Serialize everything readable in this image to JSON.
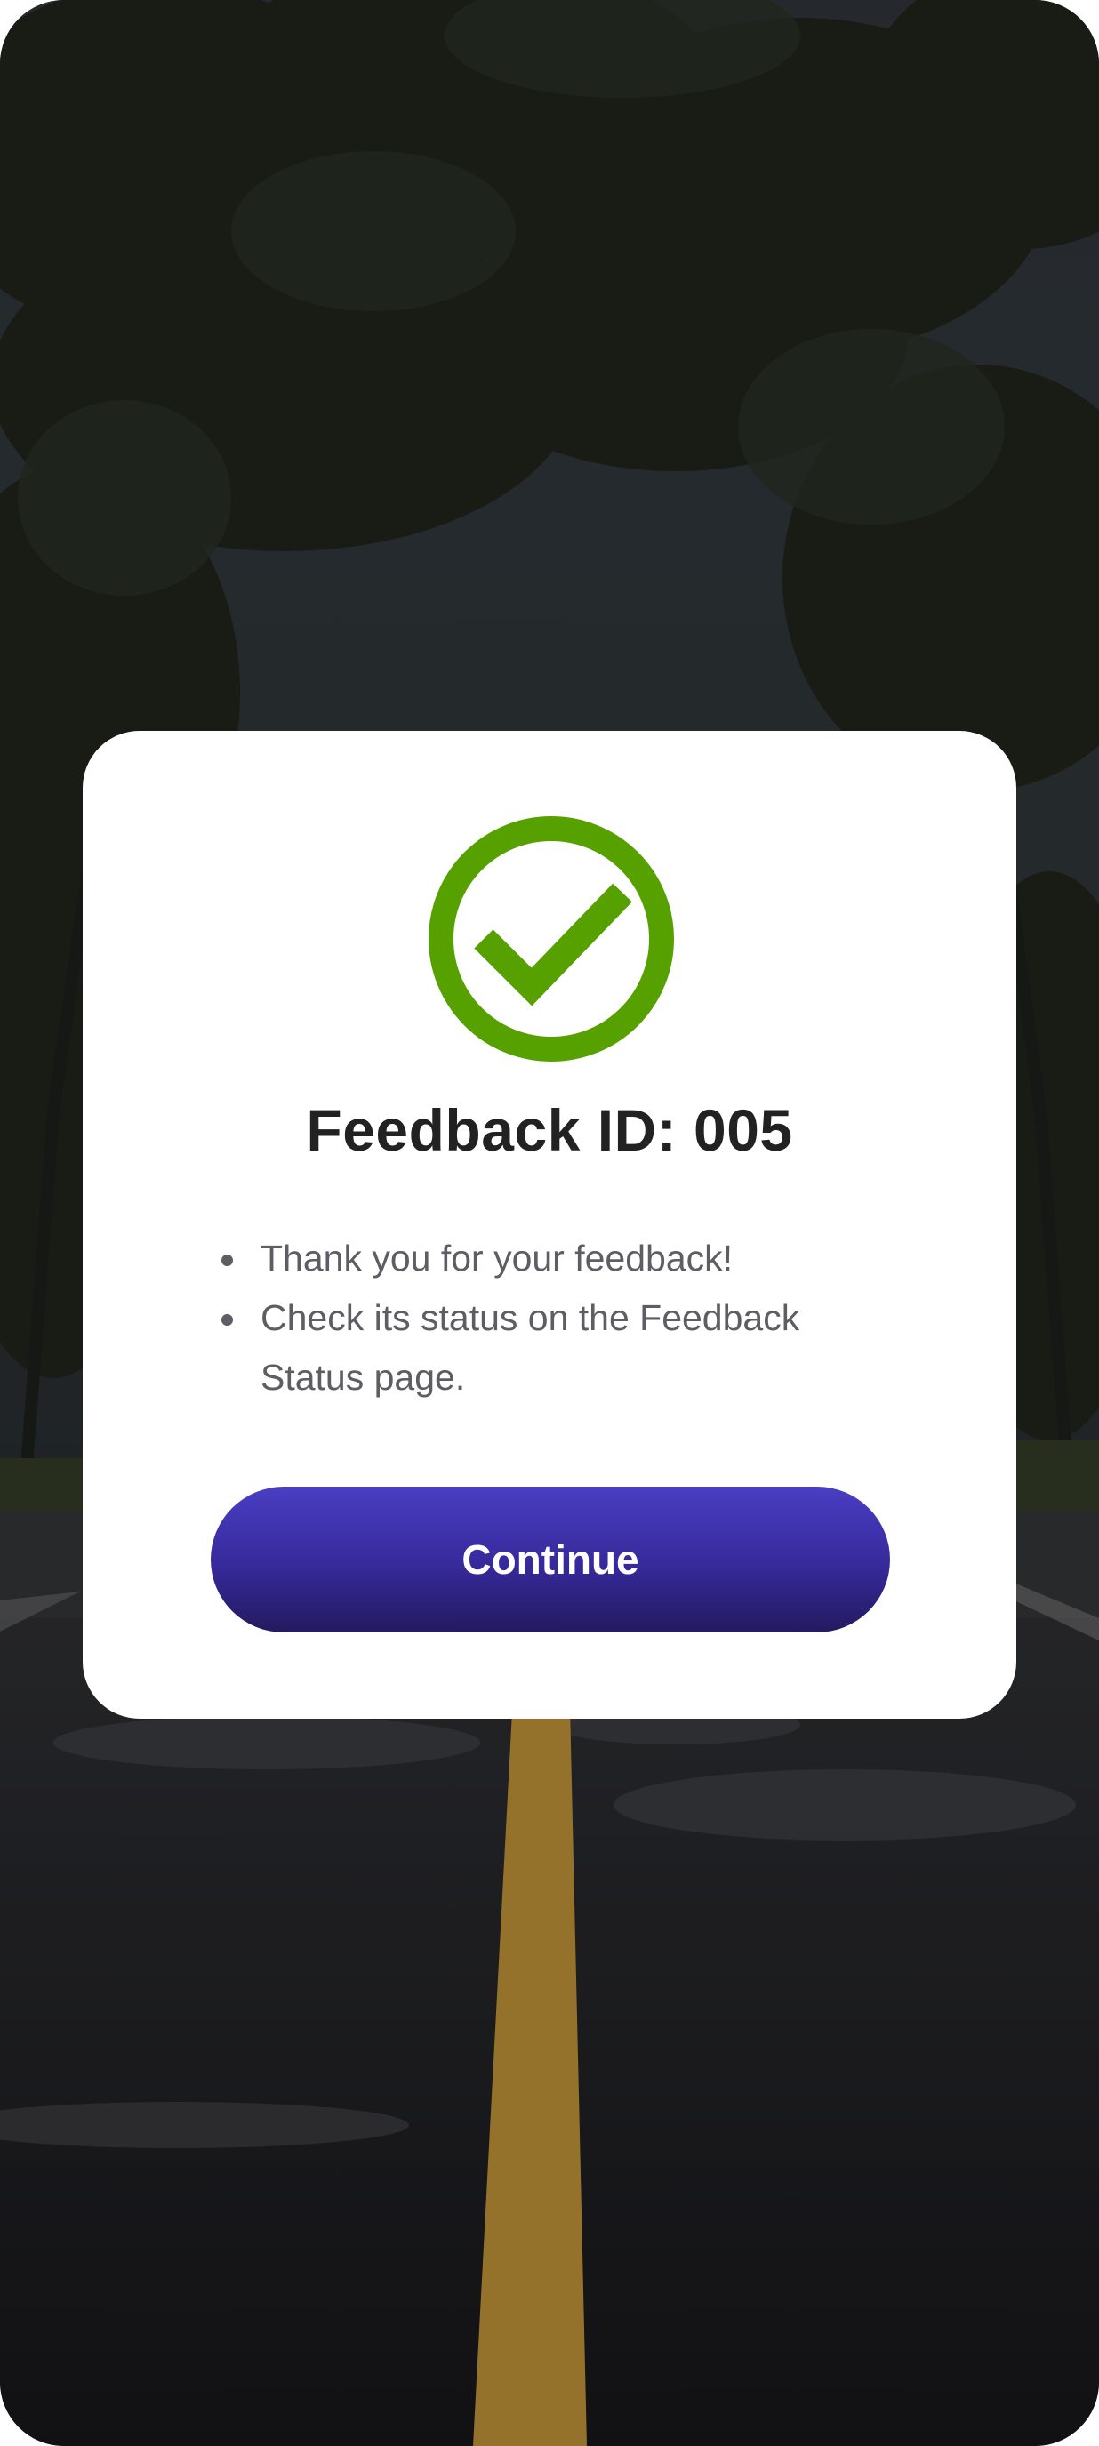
{
  "background": {
    "description_icon": "road-trees-photo",
    "road_line_color": "#b58a2e"
  },
  "modal": {
    "icon": "check-circle-icon",
    "icon_color": "#56a000",
    "title": "Feedback ID: 005",
    "messages": [
      "Thank you for your feedback!",
      "Check its status on the Feedback Status page."
    ],
    "continue_label": "Continue",
    "button_color": "#3a2ca8"
  }
}
